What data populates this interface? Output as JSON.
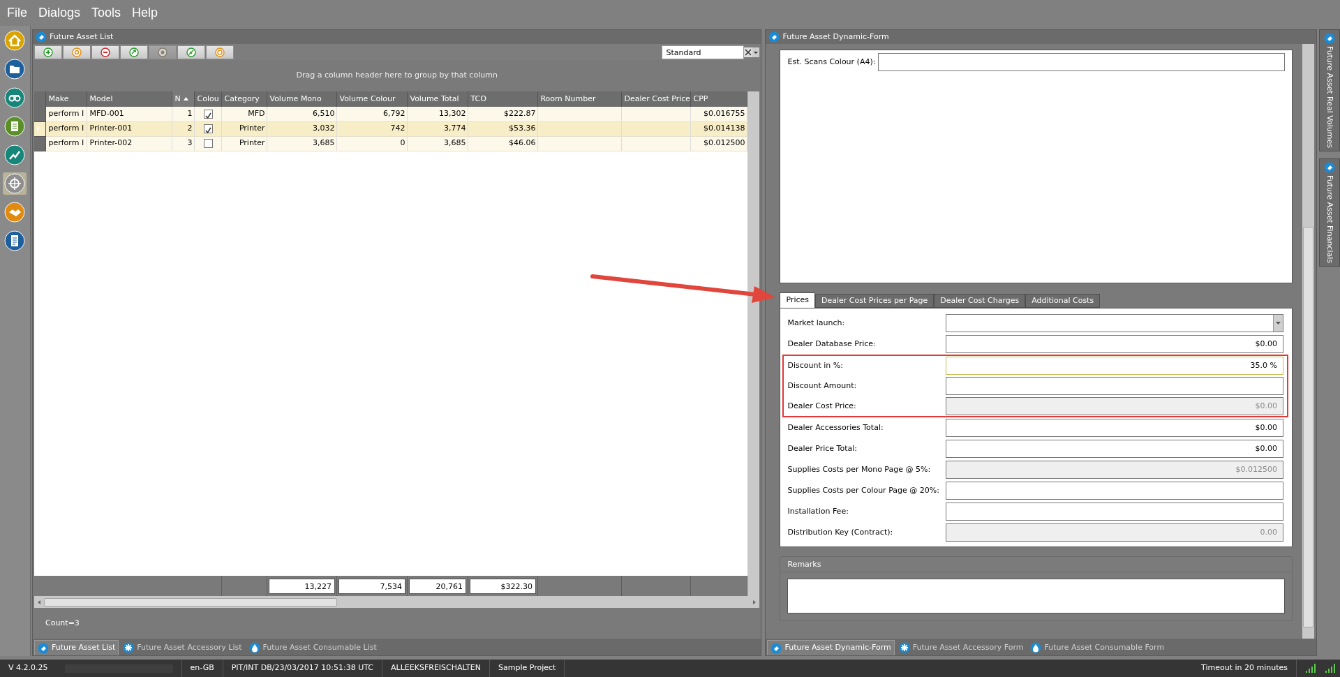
{
  "menu": [
    "File",
    "Dialogs",
    "Tools",
    "Help"
  ],
  "sidebar": {
    "items": [
      {
        "selected": false
      },
      {
        "selected": false
      },
      {
        "selected": false
      },
      {
        "selected": false
      },
      {
        "selected": false
      },
      {
        "selected": true
      },
      {
        "selected": false
      },
      {
        "selected": false
      }
    ]
  },
  "list_panel": {
    "title": "Future Asset List",
    "toolbar": [
      {
        "disabled": false
      },
      {
        "disabled": false
      },
      {
        "disabled": false
      },
      {
        "disabled": false
      },
      {
        "disabled": true
      },
      {
        "disabled": false
      },
      {
        "disabled": false
      }
    ],
    "layout_select": {
      "value": "Standard"
    },
    "group_hint": "Drag a column header here to group by that column",
    "columns": [
      {
        "header": "Make",
        "sorted": false,
        "kind": "text"
      },
      {
        "header": "Model",
        "sorted": false,
        "kind": "text"
      },
      {
        "header": "N",
        "sorted": true,
        "kind": "number"
      },
      {
        "header": "Colou",
        "sorted": false,
        "kind": "check"
      },
      {
        "header": "Category",
        "sorted": false,
        "kind": "number"
      },
      {
        "header": "Volume Mono",
        "sorted": false,
        "kind": "number",
        "total": "13,227"
      },
      {
        "header": "Volume Colour",
        "sorted": false,
        "kind": "number",
        "total": "7,534"
      },
      {
        "header": "Volume Total",
        "sorted": false,
        "kind": "number",
        "total": "20,761"
      },
      {
        "header": "TCO",
        "sorted": false,
        "kind": "number",
        "total": "$322.30"
      },
      {
        "header": "Room Number",
        "sorted": false,
        "kind": "text"
      },
      {
        "header": "Dealer Cost Price",
        "sorted": false,
        "kind": "text"
      },
      {
        "header": "CPP",
        "sorted": false,
        "kind": "number"
      }
    ],
    "rows": [
      {
        "selected": false,
        "cells": [
          "perform I",
          "MFD-001",
          "1",
          true,
          "MFD",
          "6,510",
          "6,792",
          "13,302",
          "$222.87",
          null,
          null,
          "$0.016755"
        ]
      },
      {
        "selected": true,
        "cells": [
          "perform I",
          "Printer-001",
          "2",
          true,
          "Printer",
          "3,032",
          "742",
          "3,774",
          "$53.36",
          null,
          null,
          "$0.014138"
        ]
      },
      {
        "selected": false,
        "cells": [
          "perform I",
          "Printer-002",
          "3",
          false,
          "Printer",
          "3,685",
          "0",
          "3,685",
          "$46.06",
          null,
          null,
          "$0.012500"
        ]
      }
    ],
    "count": "Count=3",
    "bottom_tabs": [
      {
        "label": "Future Asset List",
        "selected": true
      },
      {
        "label": "Future Asset Accessory List",
        "selected": false
      },
      {
        "label": "Future Asset Consumable List",
        "selected": false
      }
    ]
  },
  "form_panel": {
    "title": "Future Asset Dynamic-Form",
    "top_field": {
      "label": "Est. Scans Colour (A4):"
    },
    "tabs": [
      {
        "label": "Prices",
        "selected": true
      },
      {
        "label": "Dealer Cost Prices per Page",
        "selected": false
      },
      {
        "label": "Dealer Cost Charges",
        "selected": false
      },
      {
        "label": "Additional Costs",
        "selected": false
      }
    ],
    "fields": [
      {
        "label": "Market launch:",
        "kind": "dropdown",
        "readonly": false,
        "focused": false,
        "highlighted": false
      },
      {
        "label": "Dealer Database Price:",
        "kind": "text",
        "value": "$0.00",
        "readonly": false,
        "focused": false,
        "highlighted": false
      },
      {
        "label": "Discount in %:",
        "kind": "text",
        "value": "35.0 %",
        "readonly": false,
        "focused": true,
        "highlighted": true
      },
      {
        "label": "Discount Amount:",
        "kind": "text",
        "readonly": false,
        "focused": false,
        "highlighted": true
      },
      {
        "label": "Dealer Cost Price:",
        "kind": "text",
        "value": "$0.00",
        "readonly": true,
        "focused": false,
        "highlighted": true
      },
      {
        "label": "Dealer Accessories Total:",
        "kind": "text",
        "value": "$0.00",
        "readonly": false,
        "focused": false,
        "highlighted": false
      },
      {
        "label": "Dealer Price Total:",
        "kind": "text",
        "value": "$0.00",
        "readonly": false,
        "focused": false,
        "highlighted": false
      },
      {
        "label": "Supplies Costs per Mono Page @ 5%:",
        "kind": "text",
        "value": "$0.012500",
        "readonly": true,
        "focused": false,
        "highlighted": false
      },
      {
        "label": "Supplies Costs per Colour Page @ 20%:",
        "kind": "text",
        "readonly": false,
        "focused": false,
        "highlighted": false
      },
      {
        "label": "Installation Fee:",
        "kind": "text",
        "readonly": false,
        "focused": false,
        "highlighted": false
      },
      {
        "label": "Distribution Key (Contract):",
        "kind": "text",
        "value": "0.00",
        "readonly": true,
        "focused": false,
        "highlighted": false
      }
    ],
    "remarks": {
      "title": "Remarks"
    },
    "bottom_tabs": [
      {
        "label": "Future Asset Dynamic-Form",
        "selected": true
      },
      {
        "label": "Future Asset Accessory Form",
        "selected": false
      },
      {
        "label": "Future Asset Consumable Form",
        "selected": false
      }
    ]
  },
  "side_tabs": [
    "Future Asset Real Volumes",
    "Future Asset Financials"
  ],
  "status_bar": {
    "version": "V 4.2.0.25",
    "locale": "en-GB",
    "database": "PIT/INT DB/23/03/2017 10:51:38 UTC",
    "user": "ALLEEKSFREISCHALTEN",
    "project": "Sample Project",
    "timeout": "Timeout in 20 minutes"
  },
  "annotation": {
    "arrow": true
  }
}
